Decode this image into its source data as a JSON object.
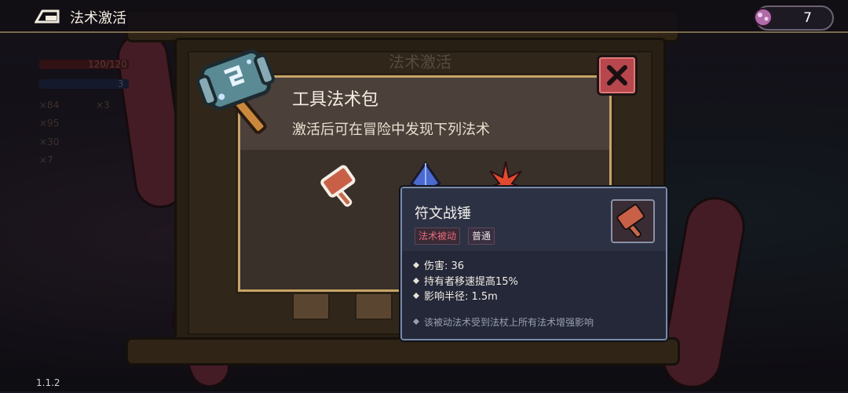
{
  "header": {
    "title": "法术激活",
    "currency_value": "7"
  },
  "hud": {
    "hp": "120/120",
    "mp": "3",
    "counts": [
      "×84",
      "×3",
      "×95",
      "×30",
      "×7"
    ]
  },
  "dialog": {
    "frame_title": "法术激活",
    "pack_name": "工具法术包",
    "pack_desc": "激活后可在冒险中发现下列法术"
  },
  "tooltip": {
    "name": "符文战锤",
    "tag_type": "法术被动",
    "tag_rarity": "普通",
    "stats": [
      "伤害: 36",
      "持有者移速提高15%",
      "影响半径: 1.5m"
    ],
    "note": "该被动法术受到法杖上所有法术增强影响"
  },
  "footer": {
    "version": "1.1.2"
  },
  "colors": {
    "accent_gold": "#c6a468",
    "close_red": "#b7474c",
    "passive_pink": "#e86a7a"
  }
}
